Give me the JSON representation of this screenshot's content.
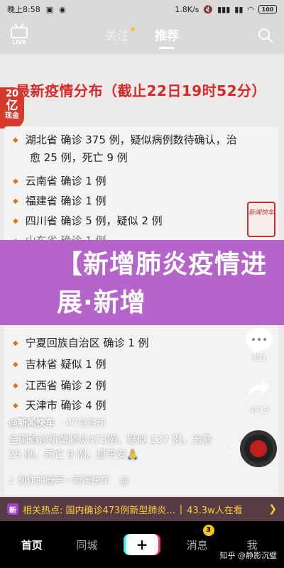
{
  "status_bar": {
    "time": "晚上8:58",
    "speed": "1.8K/s",
    "battery": "100"
  },
  "top_nav": {
    "live_label": "LIVE",
    "tabs": [
      {
        "label": "关注"
      },
      {
        "label": "推荐"
      }
    ]
  },
  "video": {
    "headline": "最新疫情分布（截止22日19时52分）",
    "promo": {
      "line1": "20",
      "line2": "亿",
      "line3": "现金"
    },
    "items": [
      {
        "text": "湖北省 确诊 375 例，疑似病例数待确认，治",
        "cont": "愈 25 例，死亡 9 例"
      },
      {
        "text": "云南省 确诊 1 例"
      },
      {
        "text": "福建省 确诊 1 例"
      },
      {
        "text": "四川省 确诊 5 例，疑似 2 例"
      },
      {
        "text": "山东省 确诊 1 例"
      },
      {
        "text": "宁夏回族自治区 确诊 1 例"
      },
      {
        "text": "吉林省 疑似 1 例"
      },
      {
        "text": "江西省 确诊 2 例"
      },
      {
        "text": "天津市 确诊 4 例"
      }
    ],
    "stamp": "新闻快车",
    "banner": "【新增肺炎疫情进展·新增"
  },
  "actions": {
    "comments": "391",
    "shares": "4513"
  },
  "caption": {
    "author": "@新闻快车",
    "time": "· 47分钟前",
    "text": "全国确诊新型肺炎473例，疑似 137 例，治愈 25 例，死亡 9 例。愿平安🙏",
    "music": "创作的原声－新闻快车",
    "music_suffix": "@"
  },
  "hot_topic": {
    "icon": "新",
    "text": "相关热点: 国内确诊473例新型肺炎...",
    "sep": "|",
    "count": "43.3w人在看"
  },
  "bottom_nav": {
    "items": [
      {
        "label": "首页"
      },
      {
        "label": "同城"
      },
      {
        "label": "+"
      },
      {
        "label": "消息",
        "badge": "3"
      },
      {
        "label": "我"
      }
    ]
  },
  "watermark": "知乎 @静影沉璧"
}
